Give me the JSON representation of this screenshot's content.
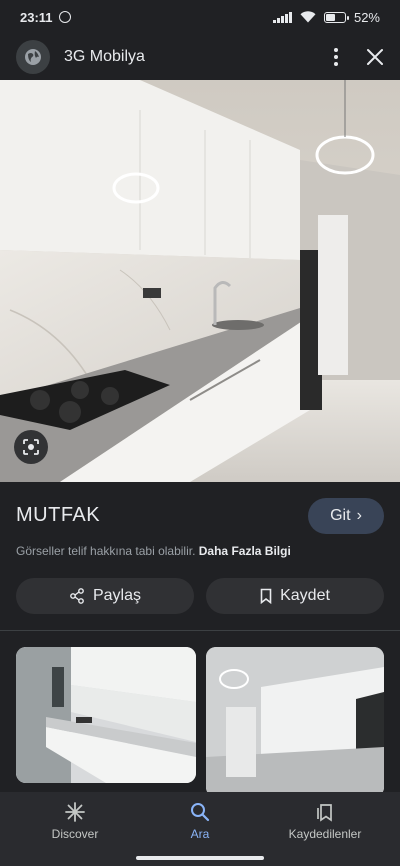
{
  "status_bar": {
    "time": "23:11",
    "battery": "52%",
    "battery_level": 0.52
  },
  "header": {
    "site_name": "3G Mobilya"
  },
  "result": {
    "title": "MUTFAK",
    "visit_label": "Git",
    "copyright_text": "Görseller telif hakkına tabi olabilir.",
    "learn_more": "Daha Fazla Bilgi",
    "share_label": "Paylaş",
    "save_label": "Kaydet"
  },
  "bottom_nav": {
    "items": [
      {
        "label": "Discover",
        "icon": "asterisk-icon",
        "active": false
      },
      {
        "label": "Ara",
        "icon": "search-icon",
        "active": true
      },
      {
        "label": "Kaydedilenler",
        "icon": "saved-collections-icon",
        "active": false
      }
    ]
  },
  "colors": {
    "accent": "#8ab4f8",
    "background": "#202124",
    "chip": "#303134",
    "git_button": "#394457"
  }
}
